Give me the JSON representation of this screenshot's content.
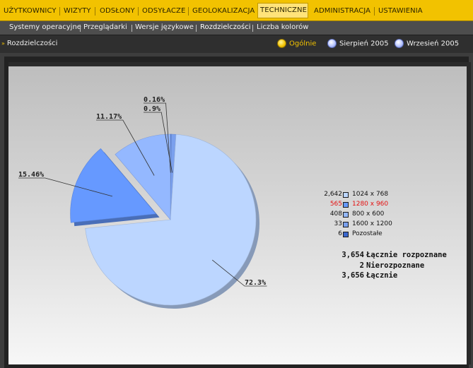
{
  "topnav": {
    "tabs": [
      {
        "label": "UŻYTKOWNICY"
      },
      {
        "label": "WIZYTY"
      },
      {
        "label": "ODSŁONY"
      },
      {
        "label": "ODSYŁACZE"
      },
      {
        "label": "GEOLOKALIZACJA"
      },
      {
        "label": "TECHNICZNE",
        "active": true
      },
      {
        "label": "ADMINISTRACJA"
      },
      {
        "label": "USTAWIENIA"
      }
    ]
  },
  "subnav": {
    "items": [
      {
        "label": "Systemy operacyjne"
      },
      {
        "label": "Przeglądarki"
      },
      {
        "label": "Wersje językowe"
      },
      {
        "label": "Rozdzielczości",
        "active": true
      },
      {
        "label": "Liczba kolorów"
      }
    ]
  },
  "toolbar": {
    "breadcrumb": "Rozdzielczości",
    "periods": [
      {
        "label": "Ogólnie",
        "selected": true
      },
      {
        "label": "Sierpień 2005",
        "selected": false
      },
      {
        "label": "Wrzesień 2005",
        "selected": false
      }
    ]
  },
  "colors": {
    "nav_yellow": "#f2c200",
    "slice_1024": "#bcd6ff",
    "slice_1280": "#6699ff",
    "slice_800": "#94b8ff",
    "slice_1600": "#7aa0ee",
    "slice_other": "#3a66cc",
    "highlight_red": "#e41010"
  },
  "chart_data": {
    "type": "pie",
    "slices": [
      {
        "label": "1024 x 768",
        "count": 2642,
        "percent": 72.3,
        "color": "#bcd6ff",
        "exploded": false
      },
      {
        "label": "1280 x 960",
        "count": 565,
        "percent": 15.46,
        "color": "#6699ff",
        "exploded": true
      },
      {
        "label": "800 x 600",
        "count": 408,
        "percent": 11.17,
        "color": "#94b8ff",
        "exploded": false
      },
      {
        "label": "1600 x 1200",
        "count": 33,
        "percent": 0.9,
        "color": "#7aa0ee",
        "exploded": false
      },
      {
        "label": "Pozostałe",
        "count": 6,
        "percent": 0.16,
        "color": "#3a66cc",
        "exploded": false
      }
    ],
    "percent_labels": [
      "72.3%",
      "15.46%",
      "11.17%",
      "0.9%",
      "0.16%"
    ]
  },
  "legend": {
    "rows": [
      {
        "count": "2,642",
        "label": "1024 x 768",
        "color": "#bcd6ff",
        "highlight": false
      },
      {
        "count": "565",
        "label": "1280 x 960",
        "color": "#6699ff",
        "highlight": true
      },
      {
        "count": "408",
        "label": "800 x 600",
        "color": "#94b8ff",
        "highlight": false
      },
      {
        "count": "33",
        "label": "1600 x 1200",
        "color": "#7aa0ee",
        "highlight": false
      },
      {
        "count": "6",
        "label": "Pozostałe",
        "color": "#3a66cc",
        "highlight": false
      }
    ]
  },
  "totals": {
    "recognized": {
      "value": "3,654",
      "label": "Łącznie rozpoznane"
    },
    "unrecognized": {
      "value": "2",
      "label": "Nierozpoznane"
    },
    "total": {
      "value": "3,656",
      "label": "Łącznie"
    }
  }
}
